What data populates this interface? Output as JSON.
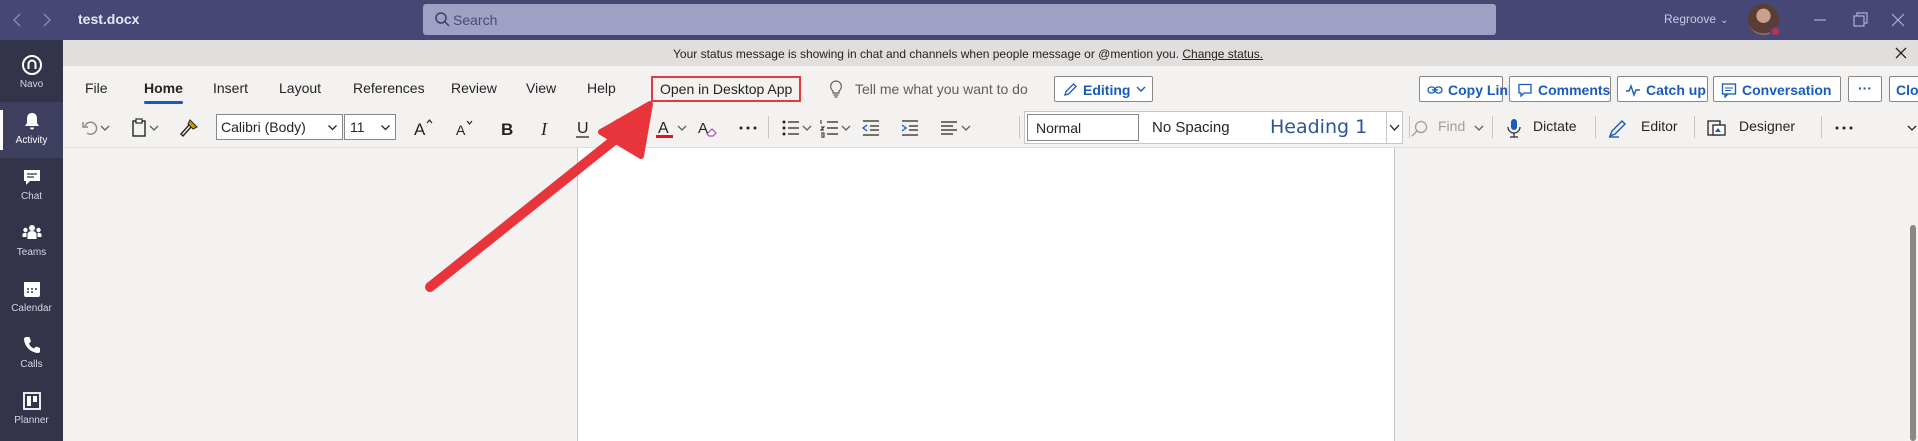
{
  "titlebar": {
    "doc_title": "test.docx",
    "search_placeholder": "Search",
    "org_name": "Regroove"
  },
  "rail": {
    "items": [
      {
        "label": "Navo",
        "icon": "navo-icon"
      },
      {
        "label": "Activity",
        "icon": "bell-icon",
        "active": true
      },
      {
        "label": "Chat",
        "icon": "chat-icon"
      },
      {
        "label": "Teams",
        "icon": "teams-icon"
      },
      {
        "label": "Calendar",
        "icon": "calendar-icon"
      },
      {
        "label": "Calls",
        "icon": "phone-icon"
      },
      {
        "label": "Planner",
        "icon": "planner-icon"
      }
    ]
  },
  "statusbar": {
    "message": "Your status message is showing in chat and channels when people message or @mention you.",
    "link": "Change status."
  },
  "ribbon": {
    "tabs": [
      "File",
      "Home",
      "Insert",
      "Layout",
      "References",
      "Review",
      "View",
      "Help"
    ],
    "active_tab": "Home",
    "open_desktop": "Open in Desktop App",
    "tell_me": "Tell me what you want to do",
    "editing": "Editing",
    "buttons": {
      "copy_link": "Copy Link",
      "comments": "Comments",
      "catch_up": "Catch up",
      "conversation": "Conversation",
      "more": "···",
      "close": "Close"
    },
    "font_name": "Calibri (Body)",
    "font_size": "11",
    "styles": {
      "normal": "Normal",
      "no_spacing": "No Spacing",
      "heading1": "Heading 1"
    },
    "find": "Find",
    "dictate": "Dictate",
    "editor": "Editor",
    "designer": "Designer"
  },
  "colors": {
    "titlebar": "#464775",
    "rail": "#33344a",
    "accent": "#185abd",
    "highlight_box": "#e23b3f"
  }
}
